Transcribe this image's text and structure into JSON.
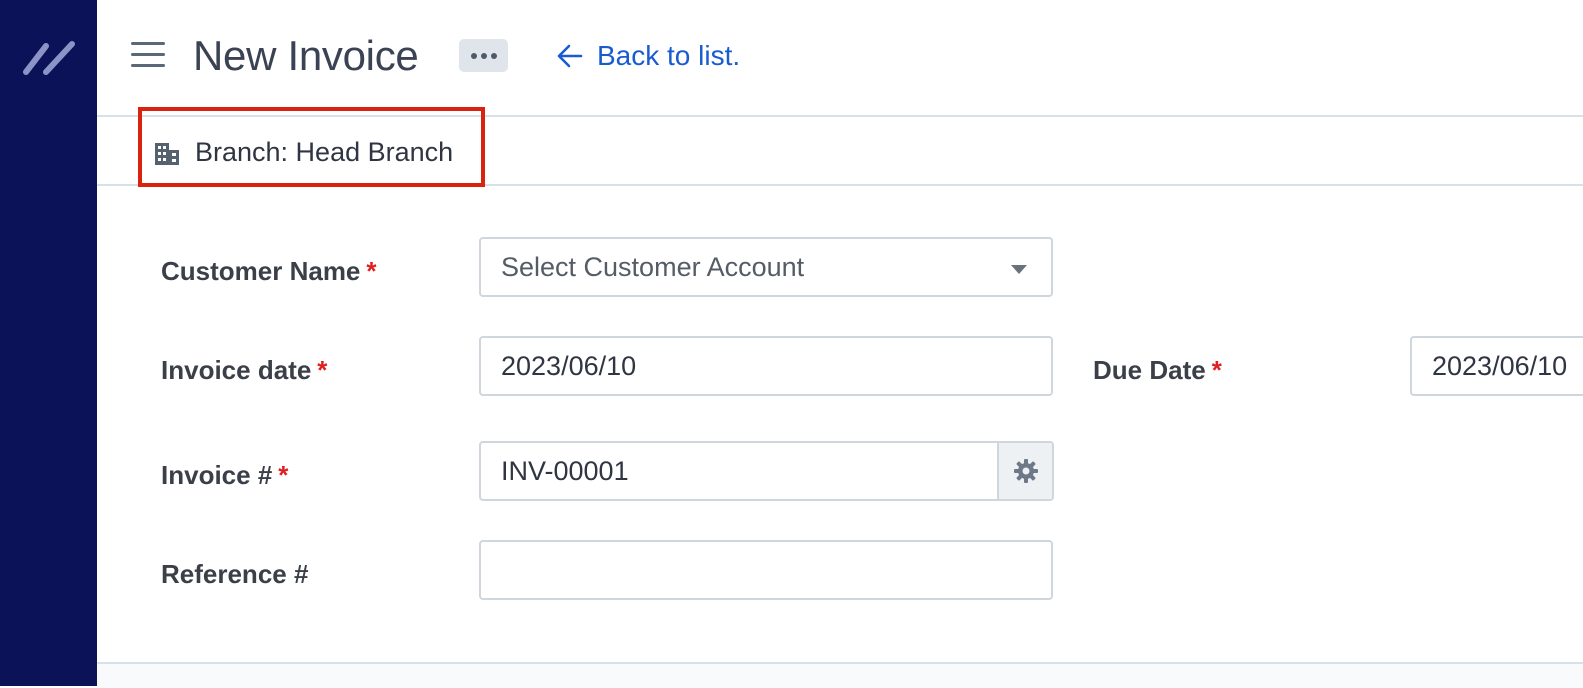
{
  "header": {
    "title": "New Invoice",
    "back_label": "Back to list."
  },
  "branch": {
    "label": "Branch: Head Branch"
  },
  "form": {
    "customer_name": {
      "label": "Customer Name",
      "required": "*",
      "placeholder": "Select Customer Account"
    },
    "invoice_date": {
      "label": "Invoice date",
      "required": "*",
      "value": "2023/06/10"
    },
    "due_date": {
      "label": "Due Date",
      "required": "*",
      "value": "2023/06/10"
    },
    "invoice_number": {
      "label": "Invoice #",
      "required": "*",
      "value": "INV-00001"
    },
    "reference_number": {
      "label": "Reference #",
      "value": ""
    }
  },
  "icons": {
    "logo": "double-slash-logo",
    "menu": "hamburger-icon",
    "more": "more-horizontal-icon",
    "back": "arrow-left-icon",
    "branch": "building-icon",
    "dropdown": "caret-down-icon",
    "settings": "gear-icon"
  },
  "colors": {
    "sidebar": "#0b1257",
    "link": "#1a5ccf",
    "required": "#e02020",
    "highlight": "#d9230f"
  }
}
